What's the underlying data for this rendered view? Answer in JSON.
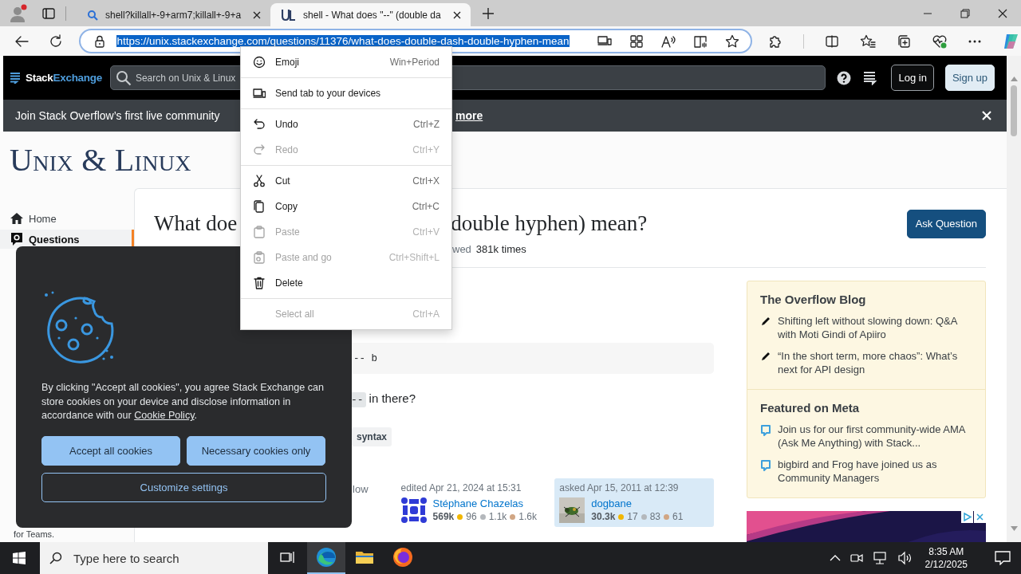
{
  "browser": {
    "tabs": [
      {
        "title": "shell?killall+-9+arm7;killall+-9+a",
        "kind": "search",
        "selected": false
      },
      {
        "title": "shell - What does \"--\" (double da",
        "kind": "site",
        "selected": true
      }
    ],
    "address": {
      "url": "https://unix.stackexchange.com/questions/11376/what-does-double-dash-double-hyphen-mean",
      "selected": true
    }
  },
  "topbar": {
    "brand": {
      "first": "Stack",
      "second": "Exchange"
    },
    "search": {
      "placeholder": "Search on Unix & Linux"
    },
    "buttons": [
      {
        "label": "Log in",
        "kind": "outline"
      },
      {
        "label": "Sign up",
        "kind": "filled"
      }
    ]
  },
  "banner": {
    "text": "Join Stack Overflow’s first live community",
    "link": "more"
  },
  "site": {
    "name": "Unix & Linux"
  },
  "nav": [
    {
      "label": "Home",
      "kind": "home",
      "selected": false
    },
    {
      "label": "Questions",
      "kind": "questions",
      "selected": true
    }
  ],
  "teams_note": "for Teams.",
  "question": {
    "title_parts": [
      "What doe",
      "double hyphen) mean?"
    ],
    "ask_button": "Ask Question",
    "meta": [
      {
        "label": "wed",
        "value": "381k times"
      }
    ],
    "code": "-- b",
    "body": {
      "code": "--",
      "text": "in there?"
    },
    "tags": [
      "syntax"
    ],
    "follow": "low",
    "cards": [
      {
        "action": "edited Apr 21, 2024 at 15:31",
        "name": "Stéphane Chazelas",
        "reputation": "569k",
        "kind": "identicon",
        "owner": false,
        "badges": [
          {
            "color": "#f1b600",
            "count": "96"
          },
          {
            "color": "#b4b8bc",
            "count": "1.1k"
          },
          {
            "color": "#d1a684",
            "count": "1.6k"
          }
        ]
      },
      {
        "action": "asked Apr 15, 2011 at 12:39",
        "name": "dogbane",
        "reputation": "30.3k",
        "kind": "picture",
        "owner": true,
        "badges": [
          {
            "color": "#f1b600",
            "count": "17"
          },
          {
            "color": "#b4b8bc",
            "count": "83"
          },
          {
            "color": "#d1a684",
            "count": "61"
          }
        ]
      }
    ]
  },
  "sidebar": {
    "widgets": [
      {
        "title": "The Overflow Blog",
        "items": [
          {
            "kind": "blog",
            "text": "Shifting left without slowing down: Q&A with Moti Gindi of Apiiro"
          },
          {
            "kind": "blog",
            "text": "“In the short term, more chaos”: What’s next for API design"
          }
        ]
      },
      {
        "title": "Featured on Meta",
        "items": [
          {
            "kind": "meta",
            "text": "Join us for our first community-wide AMA (Ask Me Anything) with Stack..."
          },
          {
            "kind": "meta",
            "text": "bigbird and Frog have joined us as Community Managers"
          }
        ]
      }
    ]
  },
  "context_menu": {
    "groups": [
      [
        {
          "label": "Emoji",
          "shortcut": "Win+Period",
          "kind": "emoji",
          "disabled": false
        }
      ],
      [
        {
          "label": "Send tab to your devices",
          "kind": "devices",
          "disabled": false
        }
      ],
      [
        {
          "label": "Undo",
          "shortcut": "Ctrl+Z",
          "kind": "undo",
          "disabled": false
        },
        {
          "label": "Redo",
          "shortcut": "Ctrl+Y",
          "kind": "redo",
          "disabled": true
        }
      ],
      [
        {
          "label": "Cut",
          "shortcut": "Ctrl+X",
          "kind": "cut",
          "disabled": false
        },
        {
          "label": "Copy",
          "shortcut": "Ctrl+C",
          "kind": "copy",
          "disabled": false
        },
        {
          "label": "Paste",
          "shortcut": "Ctrl+V",
          "kind": "paste",
          "disabled": true
        },
        {
          "label": "Paste and go",
          "shortcut": "Ctrl+Shift+L",
          "kind": "pastego",
          "disabled": true
        },
        {
          "label": "Delete",
          "kind": "delete",
          "disabled": false
        }
      ],
      [
        {
          "label": "Select all",
          "shortcut": "Ctrl+A",
          "kind": "plain",
          "disabled": true
        }
      ]
    ]
  },
  "cookie_dialog": {
    "text": "By clicking \"Accept all cookies\", you agree Stack Exchange can store cookies on your device and disclose information in accordance with our ",
    "link": "Cookie Policy",
    "after": ".",
    "buttons": [
      {
        "label": "Accept all cookies",
        "kind": "primary"
      },
      {
        "label": "Necessary cookies only",
        "kind": "primary"
      },
      {
        "label": "Customize settings",
        "kind": "outline"
      }
    ]
  },
  "taskbar": {
    "search": {
      "placeholder": "Type here to search"
    },
    "apps": [
      {
        "kind": "taskview",
        "selected": false
      },
      {
        "kind": "edge",
        "selected": true
      },
      {
        "kind": "folder",
        "selected": false
      },
      {
        "kind": "firefox",
        "selected": false
      }
    ],
    "clock": {
      "time": "8:35 AM",
      "date": "2/12/2025"
    }
  }
}
